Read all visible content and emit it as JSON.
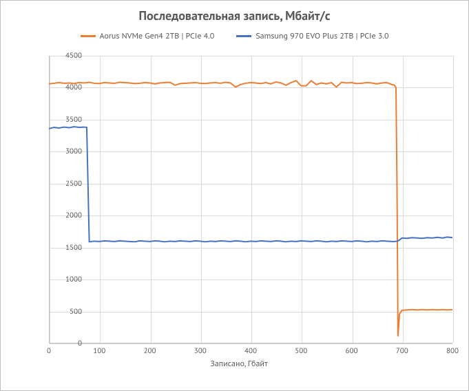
{
  "chart_data": {
    "type": "line",
    "title": "Последовательная запись, Мбайт/с",
    "xlabel": "Записано, Гбайт",
    "ylabel": "",
    "xlim": [
      0,
      800
    ],
    "ylim": [
      0,
      4500
    ],
    "xticks": [
      0,
      100,
      200,
      300,
      400,
      500,
      600,
      700,
      800
    ],
    "yticks": [
      0,
      500,
      1000,
      1500,
      2000,
      2500,
      3000,
      3500,
      4000,
      4500
    ],
    "x": [
      0,
      10,
      20,
      30,
      40,
      50,
      60,
      70,
      75,
      80,
      90,
      100,
      110,
      120,
      130,
      140,
      150,
      160,
      170,
      180,
      190,
      200,
      210,
      220,
      230,
      240,
      250,
      260,
      270,
      280,
      290,
      300,
      310,
      320,
      330,
      340,
      350,
      360,
      370,
      380,
      390,
      400,
      410,
      420,
      430,
      440,
      450,
      460,
      470,
      480,
      490,
      500,
      510,
      520,
      530,
      540,
      550,
      560,
      570,
      580,
      590,
      600,
      610,
      620,
      630,
      640,
      650,
      660,
      670,
      680,
      685,
      688,
      690,
      692,
      695,
      700,
      710,
      720,
      730,
      740,
      750,
      760,
      770,
      780,
      790,
      800
    ],
    "series": [
      {
        "name": "Aorus NVMe Gen4 2TB | PCIe 4.0",
        "color": "#ed7d31",
        "values": [
          4060,
          4070,
          4080,
          4070,
          4075,
          4065,
          4080,
          4075,
          4080,
          4085,
          4070,
          4065,
          4080,
          4075,
          4070,
          4085,
          4080,
          4075,
          4065,
          4070,
          4080,
          4075,
          4060,
          4075,
          4080,
          4085,
          4040,
          4065,
          4070,
          4075,
          4080,
          4070,
          4065,
          4075,
          4080,
          4070,
          4085,
          4075,
          4010,
          4050,
          4070,
          4080,
          4075,
          4065,
          4080,
          4060,
          4090,
          4075,
          4040,
          4080,
          4110,
          4030,
          4030,
          4110,
          4050,
          4075,
          4060,
          4080,
          4010,
          4085,
          4075,
          4080,
          4065,
          4070,
          4080,
          4075,
          4060,
          4075,
          4080,
          4050,
          4040,
          4000,
          2500,
          120,
          460,
          520,
          525,
          530,
          525,
          530,
          525,
          530,
          525,
          530,
          525,
          530
        ]
      },
      {
        "name": "Samsung 970 EVO Plus 2TB | PCIe 3.0",
        "color": "#4472c4",
        "values": [
          3360,
          3380,
          3370,
          3385,
          3375,
          3390,
          3380,
          3385,
          3380,
          1590,
          1600,
          1595,
          1605,
          1600,
          1595,
          1605,
          1600,
          1595,
          1590,
          1605,
          1600,
          1595,
          1605,
          1600,
          1590,
          1600,
          1595,
          1605,
          1600,
          1595,
          1605,
          1600,
          1590,
          1600,
          1595,
          1605,
          1600,
          1595,
          1605,
          1600,
          1590,
          1600,
          1595,
          1605,
          1600,
          1595,
          1605,
          1600,
          1590,
          1600,
          1595,
          1605,
          1600,
          1595,
          1605,
          1600,
          1590,
          1600,
          1595,
          1605,
          1600,
          1595,
          1605,
          1600,
          1590,
          1600,
          1595,
          1605,
          1600,
          1595,
          1595,
          1598,
          1600,
          1605,
          1620,
          1650,
          1645,
          1655,
          1650,
          1645,
          1655,
          1650,
          1660,
          1650,
          1665,
          1655
        ]
      }
    ]
  },
  "legend": {
    "items": [
      {
        "label": "Aorus NVMe Gen4 2TB | PCIe 4.0"
      },
      {
        "label": "Samsung 970 EVO Plus 2TB | PCIe 3.0"
      }
    ]
  }
}
